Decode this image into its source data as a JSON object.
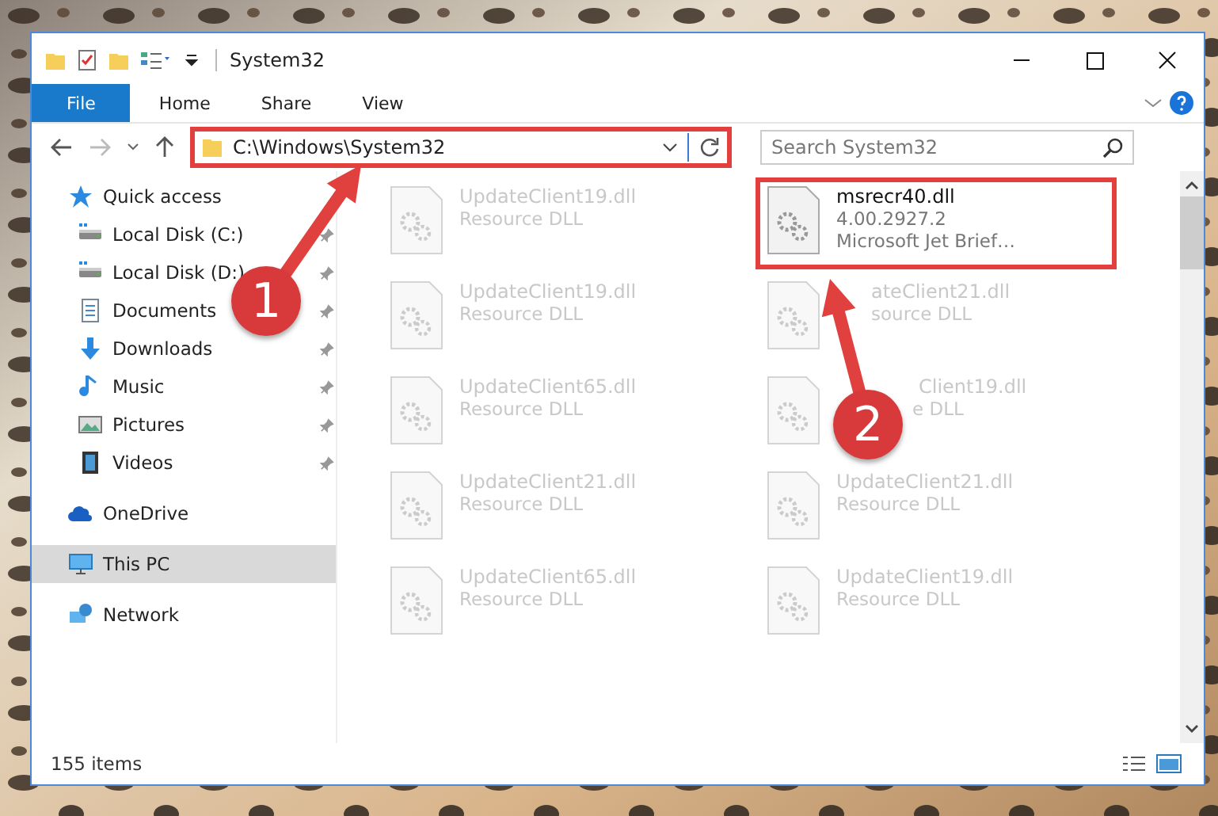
{
  "window": {
    "title": "System32"
  },
  "ribbon_tabs": [
    {
      "label": "File",
      "selected": true
    },
    {
      "label": "Home",
      "selected": false
    },
    {
      "label": "Share",
      "selected": false
    },
    {
      "label": "View",
      "selected": false
    }
  ],
  "address": {
    "value": "C:\\Windows\\System32",
    "highlighted": true
  },
  "search": {
    "placeholder": "Search System32"
  },
  "sidebar": {
    "items": [
      {
        "label": "Quick access",
        "kind": "star",
        "selected": false,
        "children": [
          {
            "label": "Local Disk (C:)",
            "kind": "disk",
            "pinned": true,
            "selected": false
          },
          {
            "label": "Local Disk (D:)",
            "kind": "disk",
            "pinned": true,
            "selected": false
          },
          {
            "label": "Documents",
            "kind": "document",
            "pinned": true,
            "selected": false
          },
          {
            "label": "Downloads",
            "kind": "download",
            "pinned": true,
            "selected": false
          },
          {
            "label": "Music",
            "kind": "music",
            "pinned": true,
            "selected": false
          },
          {
            "label": "Pictures",
            "kind": "pictures",
            "pinned": true,
            "selected": false
          },
          {
            "label": "Videos",
            "kind": "videos",
            "pinned": true,
            "selected": false
          }
        ]
      },
      {
        "label": "OneDrive",
        "kind": "cloud",
        "selected": false
      },
      {
        "label": "This PC",
        "kind": "pc",
        "selected": true
      },
      {
        "label": "Network",
        "kind": "network",
        "selected": false
      }
    ]
  },
  "files": [
    {
      "name": "UpdateClient19.dll",
      "lines": [
        "Resource DLL"
      ],
      "blurred": true,
      "highlighted": false
    },
    {
      "name": "msrecr40.dll",
      "lines": [
        "4.00.2927.2",
        "Microsoft Jet Brief…"
      ],
      "blurred": false,
      "highlighted": true
    },
    {
      "name": "UpdateClient19.dll",
      "lines": [
        "Resource DLL"
      ],
      "blurred": true,
      "highlighted": false
    },
    {
      "name": "ateClient21.dll",
      "lines": [
        "source DLL"
      ],
      "blurred": true,
      "highlighted": false
    },
    {
      "name": "UpdateClient65.dll",
      "lines": [
        "Resource DLL"
      ],
      "blurred": true,
      "highlighted": false
    },
    {
      "name": "Client19.dll",
      "lines": [
        "e DLL"
      ],
      "blurred": true,
      "highlighted": false
    },
    {
      "name": "UpdateClient21.dll",
      "lines": [
        "Resource DLL"
      ],
      "blurred": true,
      "highlighted": false
    },
    {
      "name": "UpdateClient21.dll",
      "lines": [
        "Resource DLL"
      ],
      "blurred": true,
      "highlighted": false
    },
    {
      "name": "UpdateClient65.dll",
      "lines": [
        "Resource DLL"
      ],
      "blurred": true,
      "highlighted": false
    },
    {
      "name": "UpdateClient19.dll",
      "lines": [
        "Resource DLL"
      ],
      "blurred": true,
      "highlighted": false
    }
  ],
  "status_bar": {
    "count": "155 items"
  },
  "annotations": [
    {
      "number": "1"
    },
    {
      "number": "2"
    }
  ]
}
